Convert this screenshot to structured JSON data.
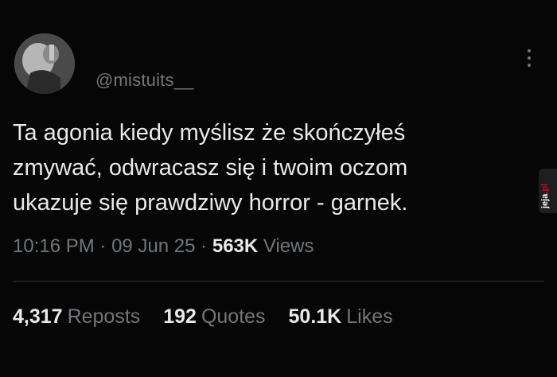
{
  "author": {
    "handle": "@mistuits__"
  },
  "tweet": {
    "lines": [
      "Ta agonia kiedy myślisz że skończyłeś",
      "zmywać, odwracasz się i twoim oczom",
      "ukazuje się prawdziwy horror - garnek."
    ],
    "time": "10:16 PM",
    "separator": "·",
    "date": "09 Jun 25",
    "views_count": "563K",
    "views_label": "Views"
  },
  "stats": {
    "reposts_count": "4,317",
    "reposts_label": "Reposts",
    "quotes_count": "192",
    "quotes_label": "Quotes",
    "likes_count": "50.1K",
    "likes_label": "Likes"
  },
  "watermark": {
    "brand": "jeja",
    "tld": ".pl"
  },
  "icons": {
    "menu": "more-vertical-icon"
  },
  "colors": {
    "background": "#060606",
    "primary_text": "#e7e9ea",
    "secondary_text": "#71767b",
    "divider": "#2f3336",
    "watermark_accent": "#e2001a"
  }
}
